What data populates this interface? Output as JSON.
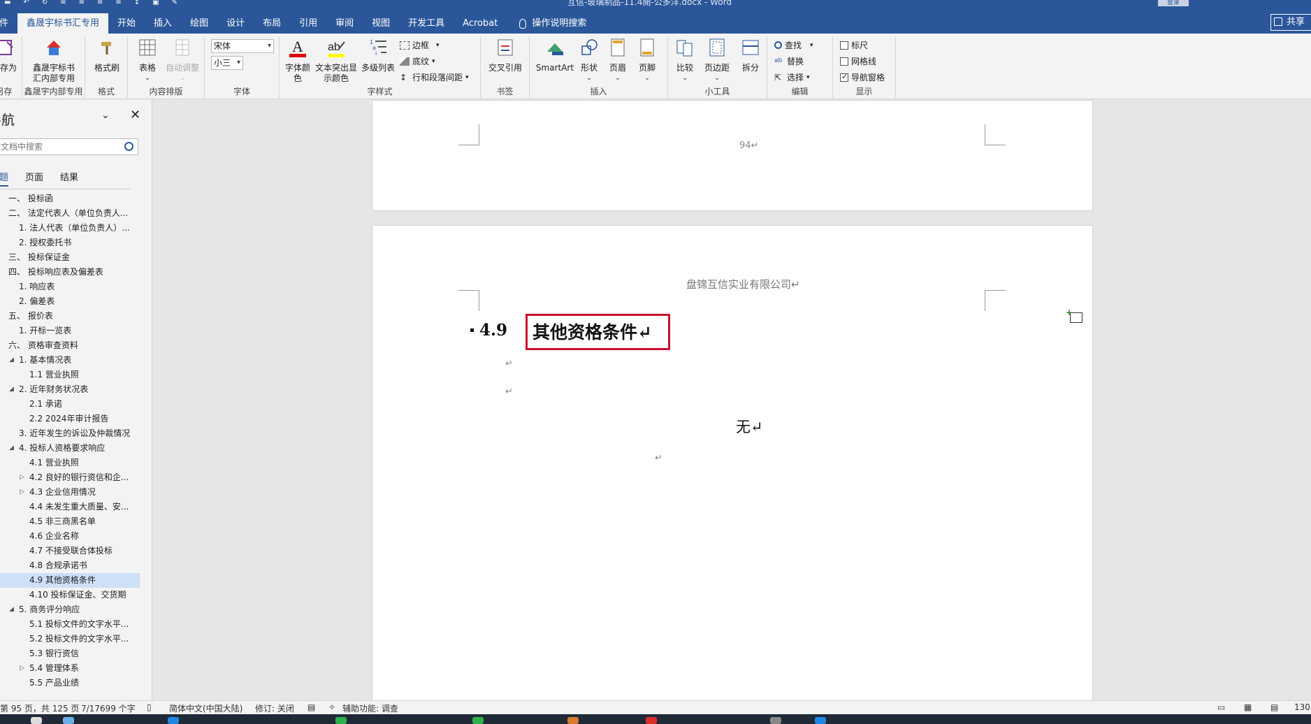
{
  "window": {
    "doc_title": "互信-玻璃制品-11.4開-公多洋.docx  -  Word",
    "login_label": "登录",
    "share_label": "共享"
  },
  "tabs": [
    {
      "label": "文件"
    },
    {
      "label": "鑫晟宇标书汇专用"
    },
    {
      "label": "开始"
    },
    {
      "label": "插入"
    },
    {
      "label": "绘图"
    },
    {
      "label": "设计"
    },
    {
      "label": "布局"
    },
    {
      "label": "引用"
    },
    {
      "label": "审阅"
    },
    {
      "label": "视图"
    },
    {
      "label": "开发工具"
    },
    {
      "label": "Acrobat"
    }
  ],
  "tell_me": "操作说明搜索",
  "ribbon": {
    "save_as": "另存为",
    "save_group": "另存",
    "xsy_button": "鑫晟宇标书汇内部专用",
    "xsy_group": "鑫晟宇内部专用",
    "format_painter": "格式刷",
    "format_group": "格式",
    "table": "表格",
    "auto_adjust": "自动调整",
    "layout_group": "内容排版",
    "font_name": "宋体",
    "font_size": "小三",
    "font_group": "字体",
    "font_color": "字体颜色",
    "highlight": "文本突出显示颜色",
    "multilevel": "多级列表",
    "border": "边框",
    "shading": "底纹",
    "line_spacing": "行和段落间距",
    "style_group": "字样式",
    "cross_ref": "交叉引用",
    "bookmark_group": "书签",
    "smartart": "SmartArt",
    "shapes": "形状",
    "header": "页眉",
    "footer": "页脚",
    "insert_group": "插入",
    "compare": "比较",
    "margins": "页边距",
    "split": "拆分",
    "tools_group": "小工具",
    "find": "查找",
    "replace": "替换",
    "select": "选择",
    "edit_group": "编辑",
    "ruler": "标尺",
    "gridlines": "网格线",
    "nav_pane": "导航窗格",
    "show_group": "显示"
  },
  "nav": {
    "title": "导航",
    "search_placeholder": "在文档中搜索",
    "tabs": [
      "标题",
      "页面",
      "结果"
    ],
    "items": [
      {
        "text": "一、 投标函",
        "level": 0
      },
      {
        "text": "二、 法定代表人（单位负责人...",
        "level": 0
      },
      {
        "text": "1. 法人代表（单位负责人）...",
        "level": 1
      },
      {
        "text": "2. 授权委托书",
        "level": 1
      },
      {
        "text": "三、 投标保证金",
        "level": 0
      },
      {
        "text": "四、 投标响应表及偏差表",
        "level": 0
      },
      {
        "text": "1. 响应表",
        "level": 1
      },
      {
        "text": "2. 偏差表",
        "level": 1
      },
      {
        "text": "五、 报价表",
        "level": 0
      },
      {
        "text": "1. 开标一览表",
        "level": 1
      },
      {
        "text": "六、 资格审查资料",
        "level": 0
      },
      {
        "text": "1. 基本情况表",
        "level": 1,
        "expanded": true
      },
      {
        "text": "1.1 营业执照",
        "level": 2
      },
      {
        "text": "2. 近年财务状况表",
        "level": 1,
        "expanded": true
      },
      {
        "text": "2.1 承诺",
        "level": 2
      },
      {
        "text": "2.2 2024年审计报告",
        "level": 2
      },
      {
        "text": "3. 近年发生的诉讼及仲裁情况",
        "level": 1
      },
      {
        "text": "4. 投标人资格要求响应",
        "level": 1,
        "expanded": true
      },
      {
        "text": "4.1 营业执照",
        "level": 2
      },
      {
        "text": "4.2 良好的银行资信和企...",
        "level": 2,
        "collapsed": true
      },
      {
        "text": "4.3 企业信用情况",
        "level": 2,
        "collapsed": true
      },
      {
        "text": "4.4 未发生重大质量、安...",
        "level": 2
      },
      {
        "text": "4.5 非三商黑名单",
        "level": 2
      },
      {
        "text": "4.6 企业名称",
        "level": 2
      },
      {
        "text": "4.7 不接受联合体投标",
        "level": 2
      },
      {
        "text": "4.8 合规承诺书",
        "level": 2
      },
      {
        "text": "4.9 其他资格条件",
        "level": 2,
        "selected": true
      },
      {
        "text": "4.10 投标保证金、交货期",
        "level": 2
      },
      {
        "text": "5. 商务评分响应",
        "level": 1,
        "expanded": true
      },
      {
        "text": "5.1 投标文件的文字水平...",
        "level": 2
      },
      {
        "text": "5.2 投标文件的文字水平...",
        "level": 2
      },
      {
        "text": "5.3 银行资信",
        "level": 2
      },
      {
        "text": "5.4 管理体系",
        "level": 2,
        "collapsed": true
      },
      {
        "text": "5.5 产品业绩",
        "level": 2
      }
    ]
  },
  "document": {
    "page_number": "94↵",
    "header_text": "盘锦互信实业有限公司↵",
    "heading_number": "4.9",
    "heading_text": "其他资格条件↵",
    "para_mark": "↵",
    "body_text": "无↵"
  },
  "status": {
    "page": "第 95 页，共 125 页",
    "words": "7/17699 个字",
    "language": "简体中文(中国大陆)",
    "track_changes": "修订: 关闭",
    "accessibility": "辅助功能: 调查",
    "zoom": "130"
  },
  "colors": {
    "title_blue": "#2b579a",
    "heading_box_red": "#c8102e",
    "nav_selected": "#cde0f7"
  }
}
